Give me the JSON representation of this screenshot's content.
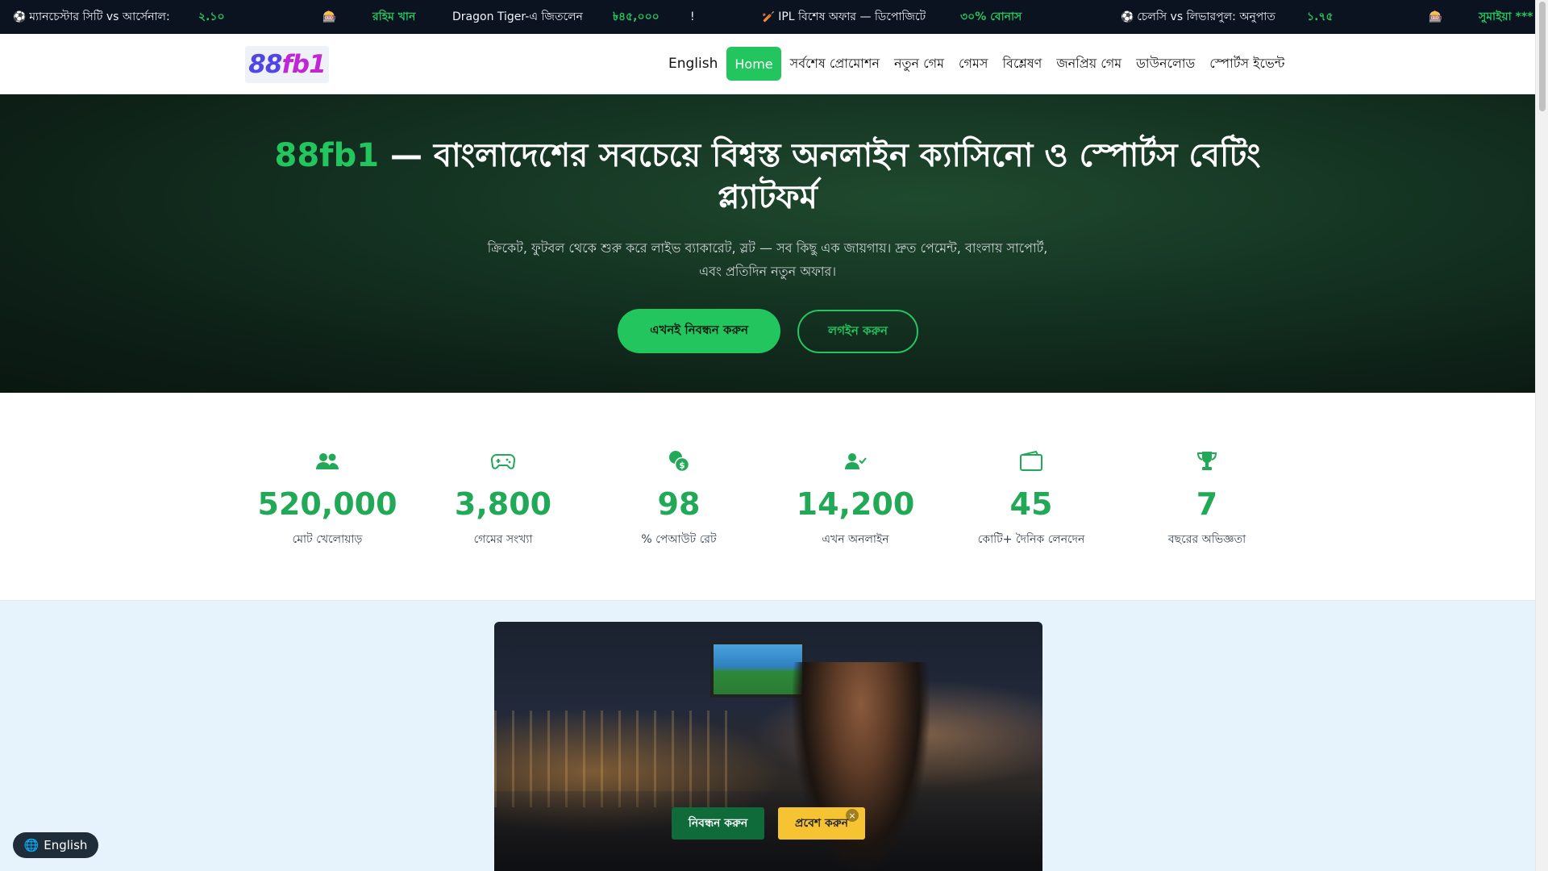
{
  "ticker": {
    "item1_text": "ম্যানচেস্টার সিটি vs আর্সেনাল:",
    "item1_value": "২.১০",
    "item2_name": "রহিম খান",
    "item2_text": "Dragon Tiger-এ জিতলেন",
    "item2_value": "৳৪৫,০০০",
    "item2_suffix": "!",
    "item3_text": "IPL বিশেষ অফার — ডিপোজিটে",
    "item3_value": "৩০% বোনাস",
    "item4_text": "চেলসি vs লিভারপুল: অনুপাত",
    "item4_value": "১.৭৫",
    "item5_name": "সুমাইয়া ***"
  },
  "header": {
    "logo_part1": "88",
    "logo_part2": "fb1",
    "nav": [
      "English",
      "Home",
      "সর্বশেষ প্রোমোশন",
      "নতুন গেম",
      "গেমস",
      "বিশ্লেষণ",
      "জনপ্রিয় গেম",
      "ডাউনলোড",
      "স্পোর্টস ইভেন্ট"
    ]
  },
  "hero": {
    "brand": "88fb1",
    "title_rest": " — বাংলাদেশের সবচেয়ে বিশ্বস্ত অনলাইন ক্যাসিনো ও স্পোর্টস বেটিং প্ল্যাটফর্ম",
    "subtitle": "ক্রিকেট, ফুটবল থেকে শুরু করে লাইভ ব্যাকারেট, স্লট — সব কিছু এক জায়গায়। দ্রুত পেমেন্ট, বাংলায় সাপোর্ট, এবং প্রতিদিন নতুন অফার।",
    "register_label": "এখনই নিবন্ধন করুন",
    "login_label": "লগইন করুন"
  },
  "stats": [
    {
      "icon": "users-icon",
      "value": "520,000",
      "label": "মোট খেলোয়াড়"
    },
    {
      "icon": "gamepad-icon",
      "value": "3,800",
      "label": "গেমের সংখ্যা"
    },
    {
      "icon": "coins-icon",
      "value": "98",
      "label": "% পেআউট রেট"
    },
    {
      "icon": "user-check-icon",
      "value": "14,200",
      "label": "এখন অনলাইন"
    },
    {
      "icon": "wallet-icon",
      "value": "45",
      "label": "কোটি+ দৈনিক লেনদেন"
    },
    {
      "icon": "trophy-icon",
      "value": "7",
      "label": "বছরের অভিজ্ঞতা"
    }
  ],
  "banner": {
    "register_label": "নিবন্ধন করুন",
    "enter_label": "প্রবেশ করুন",
    "close_label": "×"
  },
  "lang_switch": {
    "label": "English"
  },
  "colors": {
    "accent": "#22c55e",
    "hero_bg": "#143322",
    "ticker_bg": "#0b1220",
    "promo_bg": "#e6f2fc"
  }
}
